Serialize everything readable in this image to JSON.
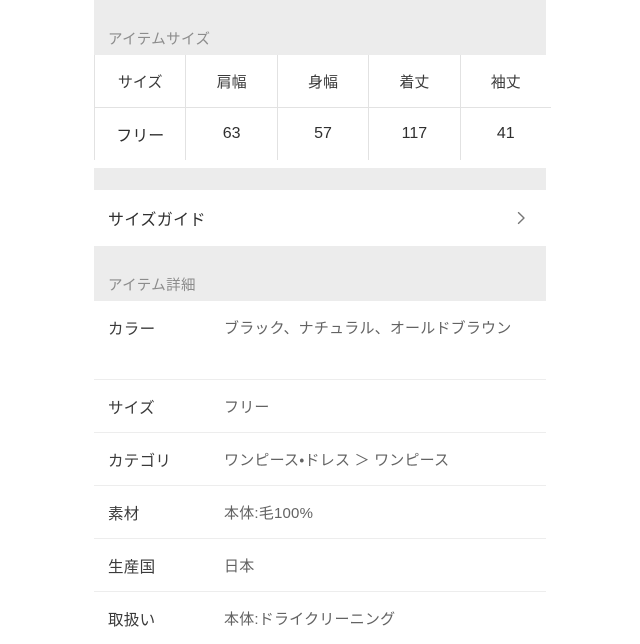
{
  "size_section": {
    "title": "アイテムサイズ",
    "table": {
      "headers": [
        "サイズ",
        "肩幅",
        "身幅",
        "着丈",
        "袖丈"
      ],
      "rows": [
        [
          "フリー",
          "63",
          "57",
          "117",
          "41"
        ]
      ]
    }
  },
  "size_guide": {
    "label": "サイズガイド",
    "chevron_icon": "chevron-right-icon"
  },
  "detail_section": {
    "title": "アイテム詳細",
    "rows": [
      {
        "label": "カラー",
        "value": "ブラック、ナチュラル、オールドブラウン"
      },
      {
        "label": "サイズ",
        "value": "フリー"
      },
      {
        "label": "カテゴリ",
        "value": "ワンピース・ドレス ＞ ワンピース"
      },
      {
        "label": "素材",
        "value": "本体:毛100%"
      },
      {
        "label": "生産国",
        "value": "日本"
      },
      {
        "label": "取扱い",
        "value": "本体:ドライクリーニング"
      }
    ]
  },
  "colors": {
    "band": "#ececec",
    "panel": "#ffffff",
    "label_text": "#3a3a3a",
    "value_text": "#636363",
    "section_title_text": "#8c8c8c",
    "divider": "#ededed",
    "table_border": "#e2e2e2"
  }
}
